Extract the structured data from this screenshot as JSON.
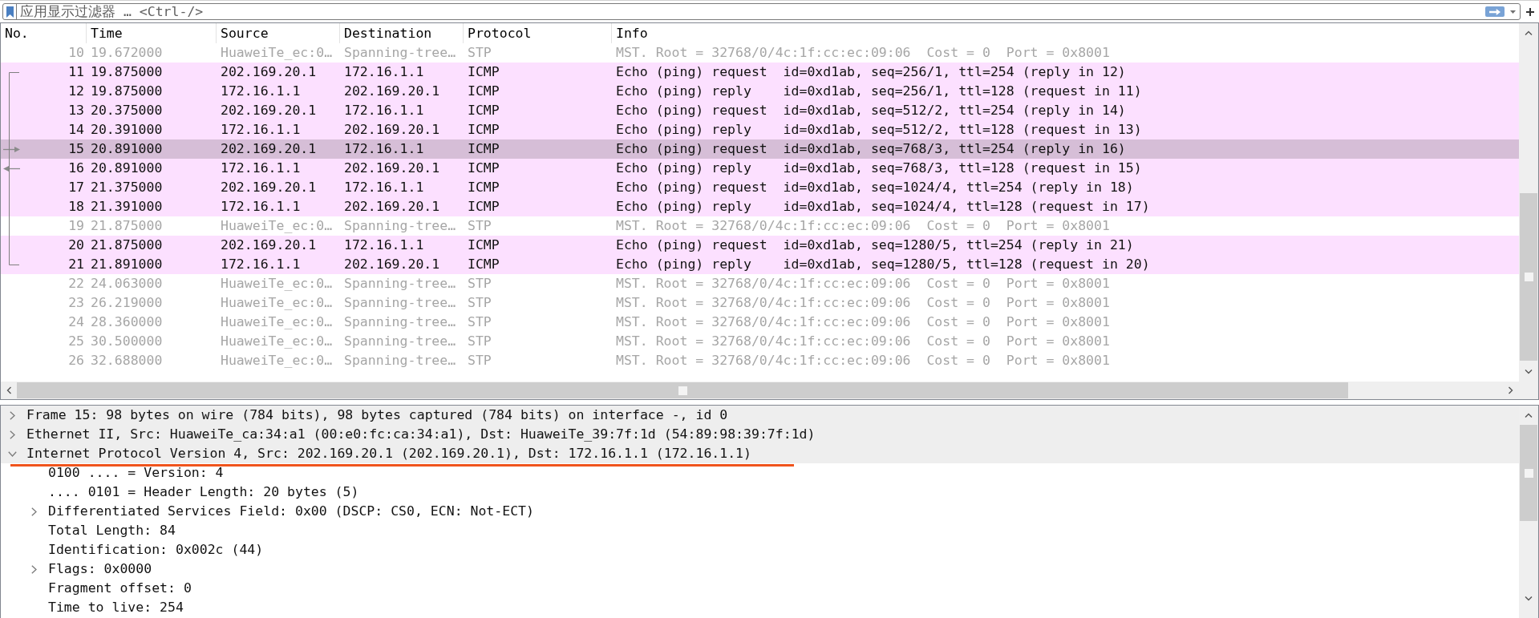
{
  "filter": {
    "placeholder": "应用显示过滤器 … <Ctrl-/>"
  },
  "packet_list": {
    "columns": [
      "No.",
      "Time",
      "Source",
      "Destination",
      "Protocol",
      "Info"
    ],
    "rows": [
      {
        "no": "10",
        "time": "19.672000",
        "source": "HuaweiTe_ec:0…",
        "destination": "Spanning-tree…",
        "protocol": "STP",
        "info": "MST. Root = 32768/0/4c:1f:cc:ec:09:06  Cost = 0  Port = 0x8001",
        "color": "#ffffff",
        "dimmed": true,
        "selected": false,
        "kind": "packet"
      },
      {
        "no": "11",
        "time": "19.875000",
        "source": "202.169.20.1",
        "destination": "172.16.1.1",
        "protocol": "ICMP",
        "info": "Echo (ping) request  id=0xd1ab, seq=256/1, ttl=254 (reply in 12)",
        "color": "#fce0ff",
        "dimmed": false,
        "selected": false,
        "kind": "first"
      },
      {
        "no": "12",
        "time": "19.875000",
        "source": "172.16.1.1",
        "destination": "202.169.20.1",
        "protocol": "ICMP",
        "info": "Echo (ping) reply    id=0xd1ab, seq=256/1, ttl=128 (request in 11)",
        "color": "#fce0ff",
        "dimmed": false,
        "selected": false,
        "kind": "packet"
      },
      {
        "no": "13",
        "time": "20.375000",
        "source": "202.169.20.1",
        "destination": "172.16.1.1",
        "protocol": "ICMP",
        "info": "Echo (ping) request  id=0xd1ab, seq=512/2, ttl=254 (reply in 14)",
        "color": "#fce0ff",
        "dimmed": false,
        "selected": false,
        "kind": "packet"
      },
      {
        "no": "14",
        "time": "20.391000",
        "source": "172.16.1.1",
        "destination": "202.169.20.1",
        "protocol": "ICMP",
        "info": "Echo (ping) reply    id=0xd1ab, seq=512/2, ttl=128 (request in 13)",
        "color": "#fce0ff",
        "dimmed": false,
        "selected": false,
        "kind": "packet"
      },
      {
        "no": "15",
        "time": "20.891000",
        "source": "202.169.20.1",
        "destination": "172.16.1.1",
        "protocol": "ICMP",
        "info": "Echo (ping) request  id=0xd1ab, seq=768/3, ttl=254 (reply in 16)",
        "dimmed": false,
        "selected": true,
        "kind": "request"
      },
      {
        "no": "16",
        "time": "20.891000",
        "source": "172.16.1.1",
        "destination": "202.169.20.1",
        "protocol": "ICMP",
        "info": "Echo (ping) reply    id=0xd1ab, seq=768/3, ttl=128 (request in 15)",
        "color": "#fce0ff",
        "dimmed": false,
        "selected": false,
        "kind": "reply"
      },
      {
        "no": "17",
        "time": "21.375000",
        "source": "202.169.20.1",
        "destination": "172.16.1.1",
        "protocol": "ICMP",
        "info": "Echo (ping) request  id=0xd1ab, seq=1024/4, ttl=254 (reply in 18)",
        "color": "#fce0ff",
        "dimmed": false,
        "selected": false,
        "kind": "packet"
      },
      {
        "no": "18",
        "time": "21.391000",
        "source": "172.16.1.1",
        "destination": "202.169.20.1",
        "protocol": "ICMP",
        "info": "Echo (ping) reply    id=0xd1ab, seq=1024/4, ttl=128 (request in 17)",
        "color": "#fce0ff",
        "dimmed": false,
        "selected": false,
        "kind": "packet"
      },
      {
        "no": "19",
        "time": "21.875000",
        "source": "HuaweiTe_ec:0…",
        "destination": "Spanning-tree…",
        "protocol": "STP",
        "info": "MST. Root = 32768/0/4c:1f:cc:ec:09:06  Cost = 0  Port = 0x8001",
        "color": "#ffffff",
        "dimmed": true,
        "selected": false,
        "kind": "packet"
      },
      {
        "no": "20",
        "time": "21.875000",
        "source": "202.169.20.1",
        "destination": "172.16.1.1",
        "protocol": "ICMP",
        "info": "Echo (ping) request  id=0xd1ab, seq=1280/5, ttl=254 (reply in 21)",
        "color": "#fce0ff",
        "dimmed": false,
        "selected": false,
        "kind": "packet"
      },
      {
        "no": "21",
        "time": "21.891000",
        "source": "172.16.1.1",
        "destination": "202.169.20.1",
        "protocol": "ICMP",
        "info": "Echo (ping) reply    id=0xd1ab, seq=1280/5, ttl=128 (request in 20)",
        "color": "#fce0ff",
        "dimmed": false,
        "selected": false,
        "kind": "last"
      },
      {
        "no": "22",
        "time": "24.063000",
        "source": "HuaweiTe_ec:0…",
        "destination": "Spanning-tree…",
        "protocol": "STP",
        "info": "MST. Root = 32768/0/4c:1f:cc:ec:09:06  Cost = 0  Port = 0x8001",
        "color": "#ffffff",
        "dimmed": true,
        "selected": false,
        "kind": "packet"
      },
      {
        "no": "23",
        "time": "26.219000",
        "source": "HuaweiTe_ec:0…",
        "destination": "Spanning-tree…",
        "protocol": "STP",
        "info": "MST. Root = 32768/0/4c:1f:cc:ec:09:06  Cost = 0  Port = 0x8001",
        "color": "#ffffff",
        "dimmed": true,
        "selected": false,
        "kind": "packet"
      },
      {
        "no": "24",
        "time": "28.360000",
        "source": "HuaweiTe_ec:0…",
        "destination": "Spanning-tree…",
        "protocol": "STP",
        "info": "MST. Root = 32768/0/4c:1f:cc:ec:09:06  Cost = 0  Port = 0x8001",
        "color": "#ffffff",
        "dimmed": true,
        "selected": false,
        "kind": "packet"
      },
      {
        "no": "25",
        "time": "30.500000",
        "source": "HuaweiTe_ec:0…",
        "destination": "Spanning-tree…",
        "protocol": "STP",
        "info": "MST. Root = 32768/0/4c:1f:cc:ec:09:06  Cost = 0  Port = 0x8001",
        "color": "#ffffff",
        "dimmed": true,
        "selected": false,
        "kind": "packet"
      },
      {
        "no": "26",
        "time": "32.688000",
        "source": "HuaweiTe_ec:0…",
        "destination": "Spanning-tree…",
        "protocol": "STP",
        "info": "MST. Root = 32768/0/4c:1f:cc:ec:09:06  Cost = 0  Port = 0x8001",
        "color": "#ffffff",
        "dimmed": true,
        "selected": false,
        "kind": "packet"
      }
    ]
  },
  "packet_details": {
    "items": [
      {
        "label": "Frame 15: 98 bytes on wire (784 bits), 98 bytes captured (784 bits) on interface -, id 0",
        "kind": "node",
        "expanded": false,
        "underlined": false
      },
      {
        "label": "Ethernet II, Src: HuaweiTe_ca:34:a1 (00:e0:fc:ca:34:a1), Dst: HuaweiTe_39:7f:1d (54:89:98:39:7f:1d)",
        "kind": "node",
        "expanded": false,
        "underlined": false
      },
      {
        "label": "Internet Protocol Version 4, Src: 202.169.20.1 (202.169.20.1), Dst: 172.16.1.1 (172.16.1.1)",
        "kind": "node",
        "expanded": true,
        "underlined": true,
        "children": [
          {
            "label": "0100 .... = Version: 4",
            "kind": "leaf"
          },
          {
            "label": ".... 0101 = Header Length: 20 bytes (5)",
            "kind": "leaf"
          },
          {
            "label": "Differentiated Services Field: 0x00 (DSCP: CS0, ECN: Not-ECT)",
            "kind": "node",
            "expanded": false
          },
          {
            "label": "Total Length: 84",
            "kind": "leaf"
          },
          {
            "label": "Identification: 0x002c (44)",
            "kind": "leaf"
          },
          {
            "label": "Flags: 0x0000",
            "kind": "node",
            "expanded": false
          },
          {
            "label": "Fragment offset: 0",
            "kind": "leaf"
          },
          {
            "label": "Time to live: 254",
            "kind": "leaf"
          }
        ]
      }
    ]
  }
}
